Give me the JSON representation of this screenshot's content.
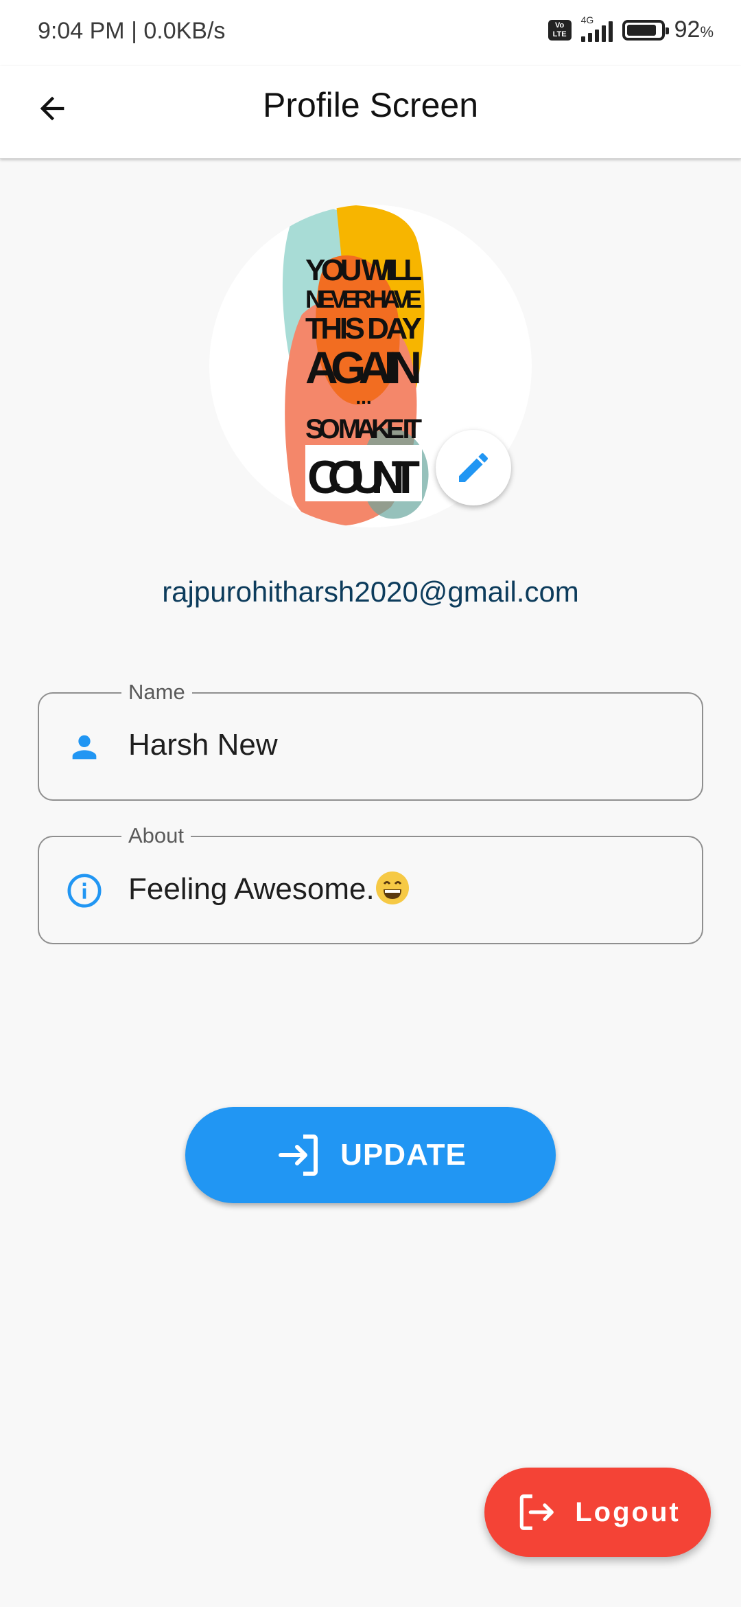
{
  "status_bar": {
    "time_speed": "9:04 PM | 0.0KB/s",
    "volte": "Vo LTE",
    "network": "4G",
    "battery_percent": "92",
    "battery_unit": "%"
  },
  "app_bar": {
    "title": "Profile Screen"
  },
  "profile": {
    "email": "rajpurohitharsh2020@gmail.com",
    "poster_lines": [
      "YOU WILL",
      "NEVER HAVE",
      "THIS DAY",
      "AGAIN",
      "...",
      "SO MAKE IT",
      "COUNT"
    ]
  },
  "form": {
    "name_label": "Name",
    "name_value": "Harsh New",
    "about_label": "About",
    "about_value": "Feeling Awesome."
  },
  "buttons": {
    "update_label": "UPDATE",
    "logout_label": "Logout"
  },
  "colors": {
    "primary": "#2196f3",
    "danger": "#f44336",
    "email_text": "#0d3c5c"
  }
}
